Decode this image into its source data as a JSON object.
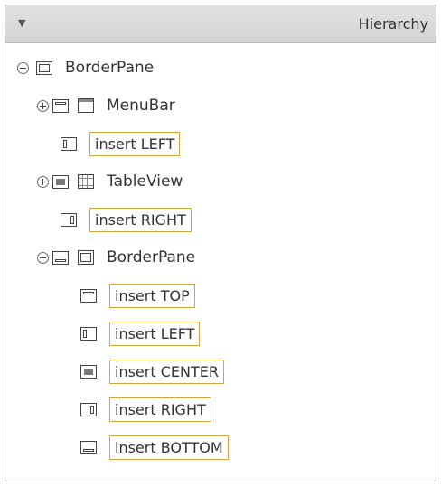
{
  "panel": {
    "collapse_glyph": "▼",
    "title": "Hierarchy"
  },
  "tree": {
    "root": {
      "label": "BorderPane"
    },
    "menubar": {
      "label": "MenuBar"
    },
    "insert_left_1": {
      "label": "insert LEFT"
    },
    "tableview": {
      "label": "TableView"
    },
    "insert_right_1": {
      "label": "insert RIGHT"
    },
    "nested": {
      "label": "BorderPane"
    },
    "nested_top": {
      "label": "insert TOP"
    },
    "nested_left": {
      "label": "insert LEFT"
    },
    "nested_center": {
      "label": "insert CENTER"
    },
    "nested_right": {
      "label": "insert RIGHT"
    },
    "nested_bottom": {
      "label": "insert BOTTOM"
    }
  },
  "colors": {
    "slot_border": "#d9a43c",
    "header_bg": "#d8d8d8"
  }
}
